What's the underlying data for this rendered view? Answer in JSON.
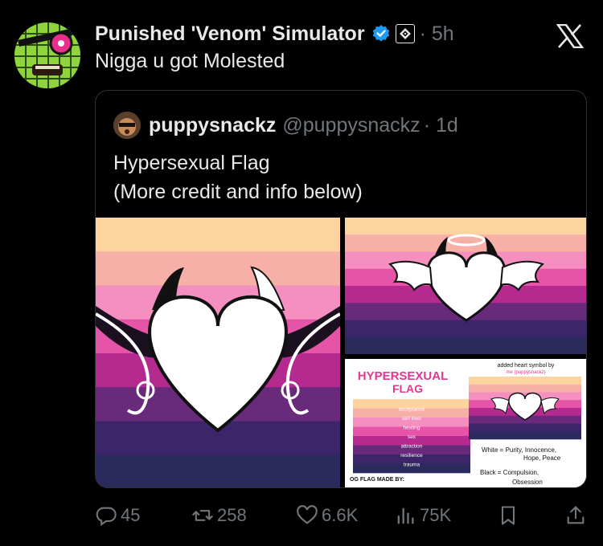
{
  "tweet": {
    "author_name": "Punished 'Venom' Simulator",
    "time": "· 5h",
    "text": "Nigga u got Molested"
  },
  "quote": {
    "author_name": "puppysnackz",
    "handle": "@puppysnackz",
    "time": "· 1d",
    "text_line1": "Hypersexual Flag",
    "text_line2": "(More credit and info below)"
  },
  "infographic": {
    "title_line1": "HYPERSEXUAL",
    "title_line2": "FLAG",
    "note": "added heart symbol by",
    "note2": "me (puppysnackz)",
    "stripe_labels": [
      "acceptance",
      "self love",
      "healing",
      "sex",
      "attraction",
      "resilience",
      "trauma"
    ],
    "white_meaning_1": "White = Purity, Innocence,",
    "white_meaning_2": "Hope, Peace",
    "black_meaning_1": "Black = Compulsion,",
    "black_meaning_2": "Obsession",
    "credit": "OG FLAG MADE BY:"
  },
  "flag_colors": [
    "#fdd3a0",
    "#f7b0a8",
    "#f58fc0",
    "#e554a6",
    "#b52a8e",
    "#6a2a7c",
    "#3c2568",
    "#2a2a5c"
  ],
  "actions": {
    "replies": "45",
    "reposts": "258",
    "likes": "6.6K",
    "views": "75K"
  },
  "icons": {
    "verified": "verified-badge-icon",
    "affiliate": "affiliate-badge-icon",
    "x_logo": "x-logo-icon",
    "reply": "reply-icon",
    "repost": "repost-icon",
    "like": "heart-icon",
    "views": "views-icon",
    "bookmark": "bookmark-icon",
    "share": "share-icon"
  },
  "colors": {
    "background": "#000000",
    "text": "#e7e9ea",
    "muted": "#71767b",
    "verified": "#1d9bf0",
    "border": "#2f3336"
  }
}
